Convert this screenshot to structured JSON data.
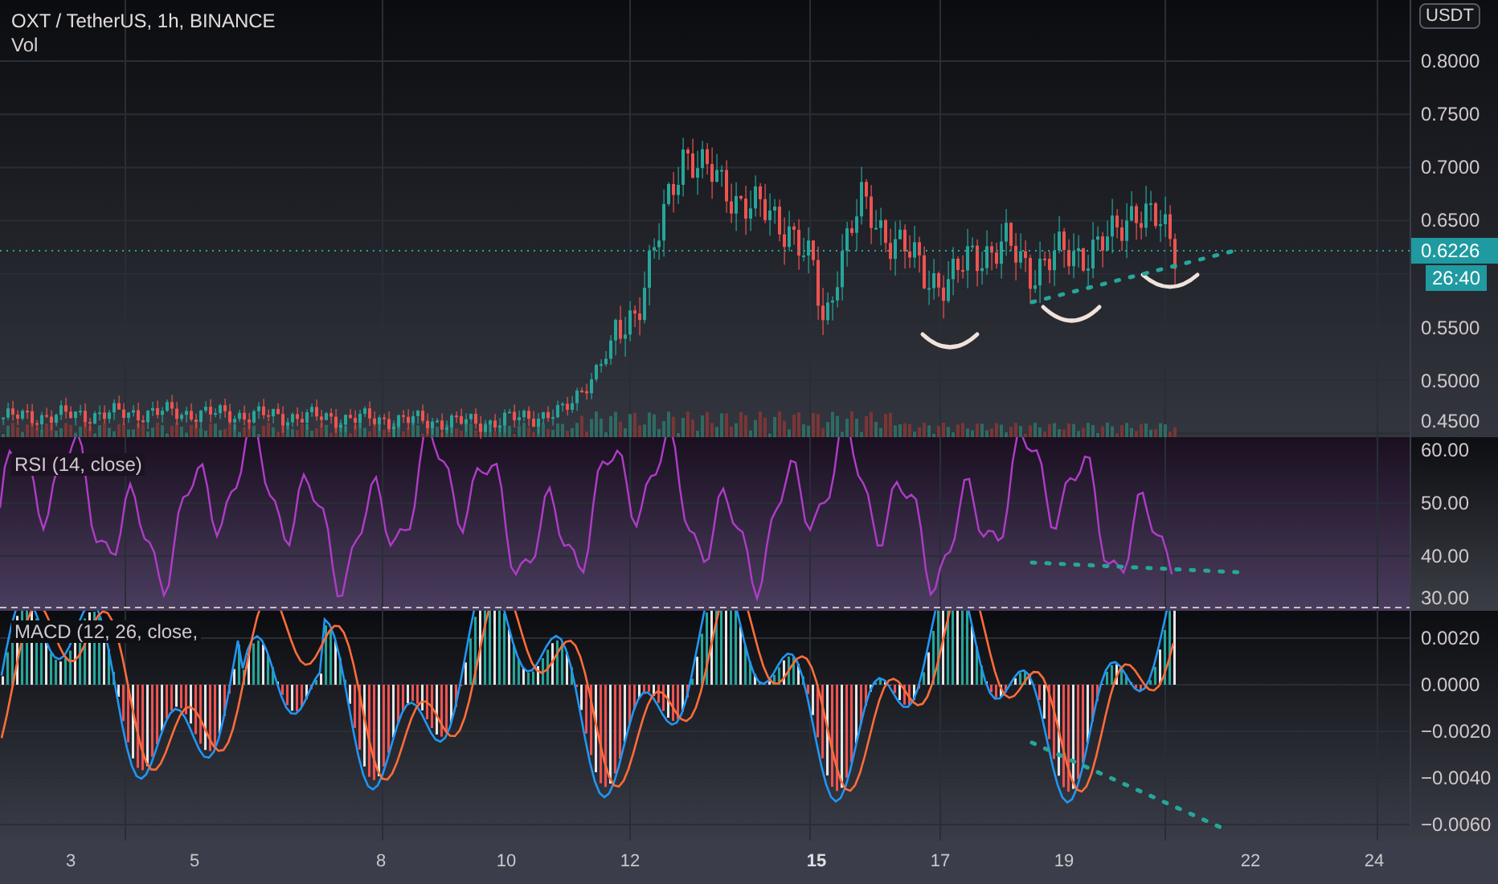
{
  "header": {
    "symbol_title": "OXT / TetherUS, 1h, BINANCE",
    "volume_label": "Vol"
  },
  "price_axis": {
    "currency": "USDT",
    "ticks": [
      "0.8000",
      "0.7500",
      "0.7000",
      "0.6500",
      "0.5500",
      "0.5000",
      "0.4500"
    ],
    "last_price": "0.6226",
    "countdown": "26:40"
  },
  "rsi": {
    "label": "RSI (14, close)",
    "ticks": [
      "60.00",
      "50.00",
      "40.00",
      "30.00"
    ]
  },
  "macd": {
    "label": "MACD (12, 26, close,",
    "ticks": [
      "0.0020",
      "0.0000",
      "−0.0020",
      "−0.0040",
      "−0.0060"
    ]
  },
  "time_axis": {
    "labels": [
      {
        "text": "3",
        "emphasized": false
      },
      {
        "text": "5",
        "emphasized": false
      },
      {
        "text": "8",
        "emphasized": false
      },
      {
        "text": "10",
        "emphasized": false
      },
      {
        "text": "12",
        "emphasized": false
      },
      {
        "text": "15",
        "emphasized": true
      },
      {
        "text": "17",
        "emphasized": false
      },
      {
        "text": "19",
        "emphasized": false
      },
      {
        "text": "22",
        "emphasized": false
      },
      {
        "text": "24",
        "emphasized": false
      }
    ]
  }
}
